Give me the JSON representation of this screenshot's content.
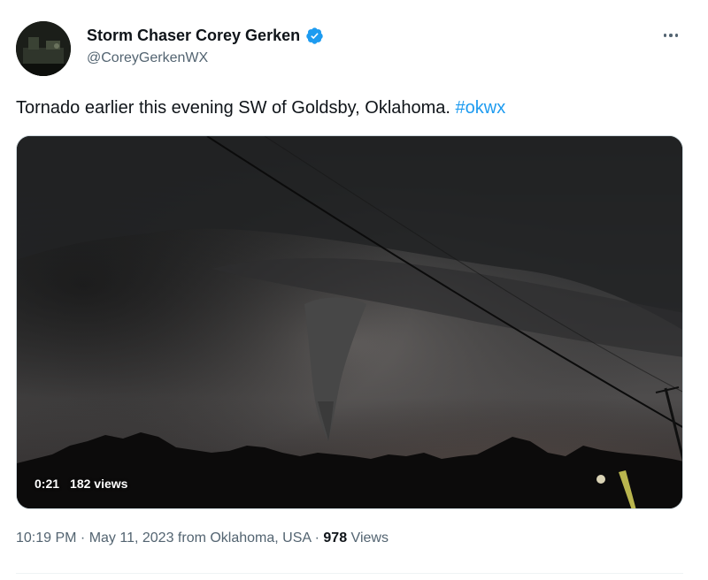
{
  "author": {
    "display_name": "Storm Chaser Corey Gerken",
    "handle": "@CoreyGerkenWX",
    "verified": true,
    "avatar_icon": "avatar-photo"
  },
  "tweet": {
    "text": "Tornado earlier this evening SW of Goldsby, Oklahoma. ",
    "hashtag": "#okwx"
  },
  "video": {
    "duration": "0:21",
    "views": "182 views"
  },
  "footer": {
    "time": "10:19 PM",
    "sep1": " · ",
    "date": "May 11, 2023",
    "source_prefix": " from ",
    "location": "Oklahoma, USA",
    "sep2": " · ",
    "view_count": "978",
    "views_label": " Views"
  },
  "colors": {
    "accent": "#1d9bf0",
    "text_primary": "#0f1419",
    "text_secondary": "#536471"
  }
}
